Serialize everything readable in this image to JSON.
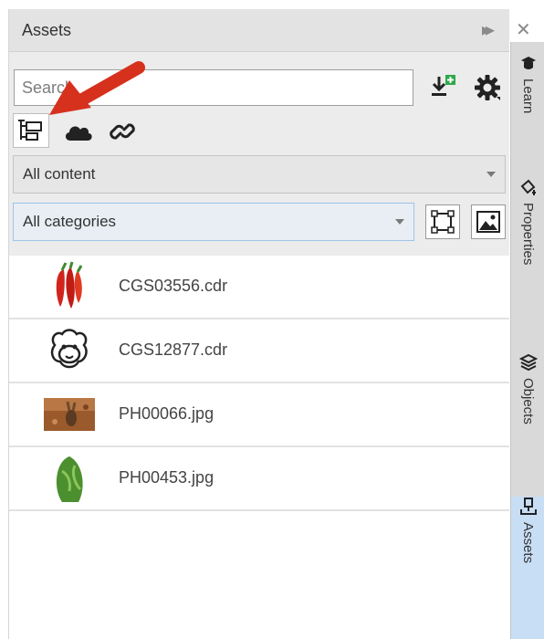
{
  "panel": {
    "title": "Assets",
    "search_placeholder": "Search",
    "source_tabs": [
      "local-folders-icon",
      "cloud-icon",
      "link-icon"
    ],
    "content_filter": "All content",
    "category_filter": "All categories"
  },
  "assets": [
    {
      "filename": "CGS03556.cdr",
      "thumb": "chili-peppers"
    },
    {
      "filename": "CGS12877.cdr",
      "thumb": "sheep-face"
    },
    {
      "filename": "PH00066.jpg",
      "thumb": "rabbit-photo"
    },
    {
      "filename": "PH00453.jpg",
      "thumb": "green-leaves"
    }
  ],
  "side_tabs": [
    {
      "label": "Learn",
      "icon": "mortarboard-icon",
      "active": false
    },
    {
      "label": "Properties",
      "icon": "properties-icon",
      "active": false
    },
    {
      "label": "Objects",
      "icon": "layers-icon",
      "active": false
    },
    {
      "label": "Assets",
      "icon": "assets-icon",
      "active": true
    }
  ],
  "colors": {
    "accent": "#c7def5",
    "arrow": "#d6311d",
    "add_badge": "#2ea84a"
  }
}
